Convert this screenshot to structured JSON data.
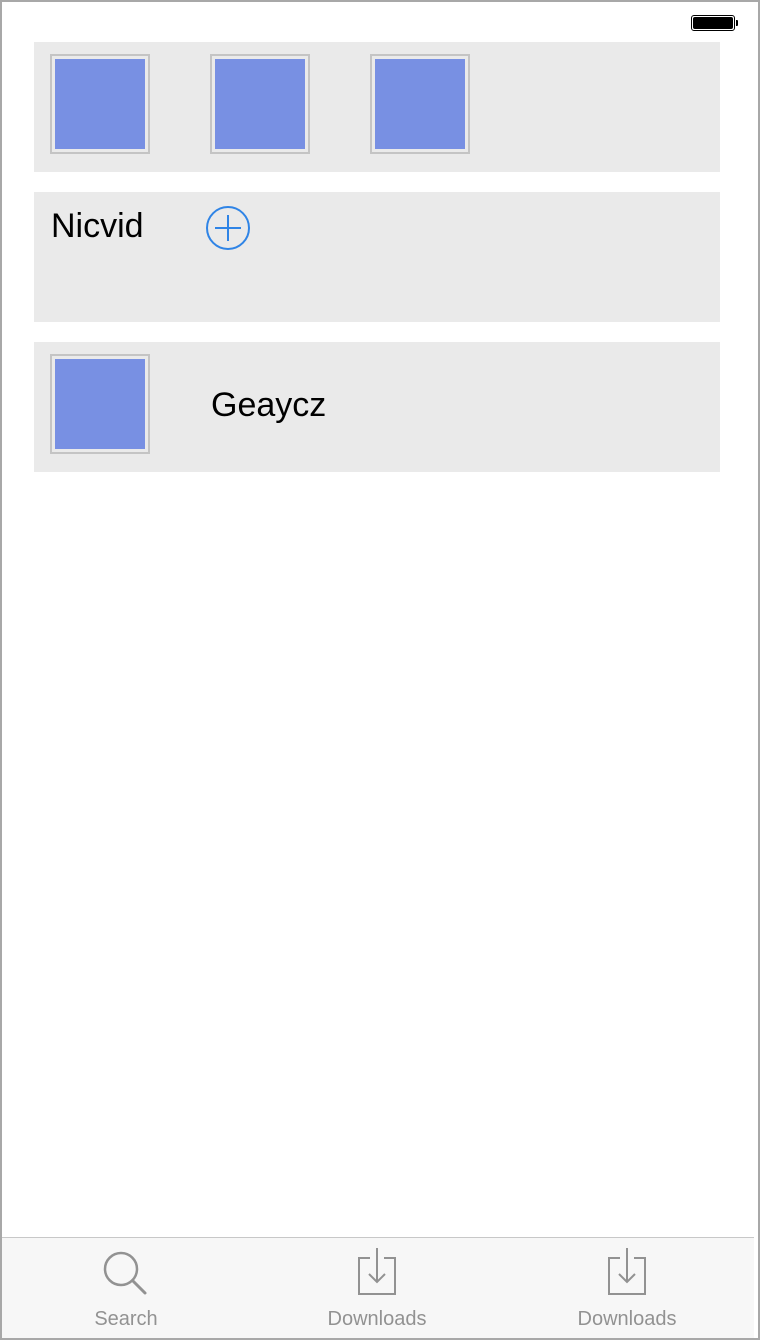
{
  "status_bar": {
    "battery_icon": "battery-full-icon"
  },
  "gallery_cell": {
    "thumbnails": [
      {
        "icon": "image-placeholder",
        "color": "#7890e3"
      },
      {
        "icon": "image-placeholder",
        "color": "#7890e3"
      },
      {
        "icon": "image-placeholder",
        "color": "#7890e3"
      }
    ]
  },
  "add_cell": {
    "title": "Nicvid",
    "add_icon": "plus-circle-icon",
    "accent_color": "#2f84e6"
  },
  "item_cell": {
    "thumbnail_color": "#7890e3",
    "label": "Geaycz"
  },
  "tab_bar": {
    "tabs": [
      {
        "label": "Search",
        "icon": "search-icon"
      },
      {
        "label": "Downloads",
        "icon": "download-icon"
      },
      {
        "label": "Downloads",
        "icon": "download-icon"
      }
    ],
    "inactive_color": "#929292"
  }
}
